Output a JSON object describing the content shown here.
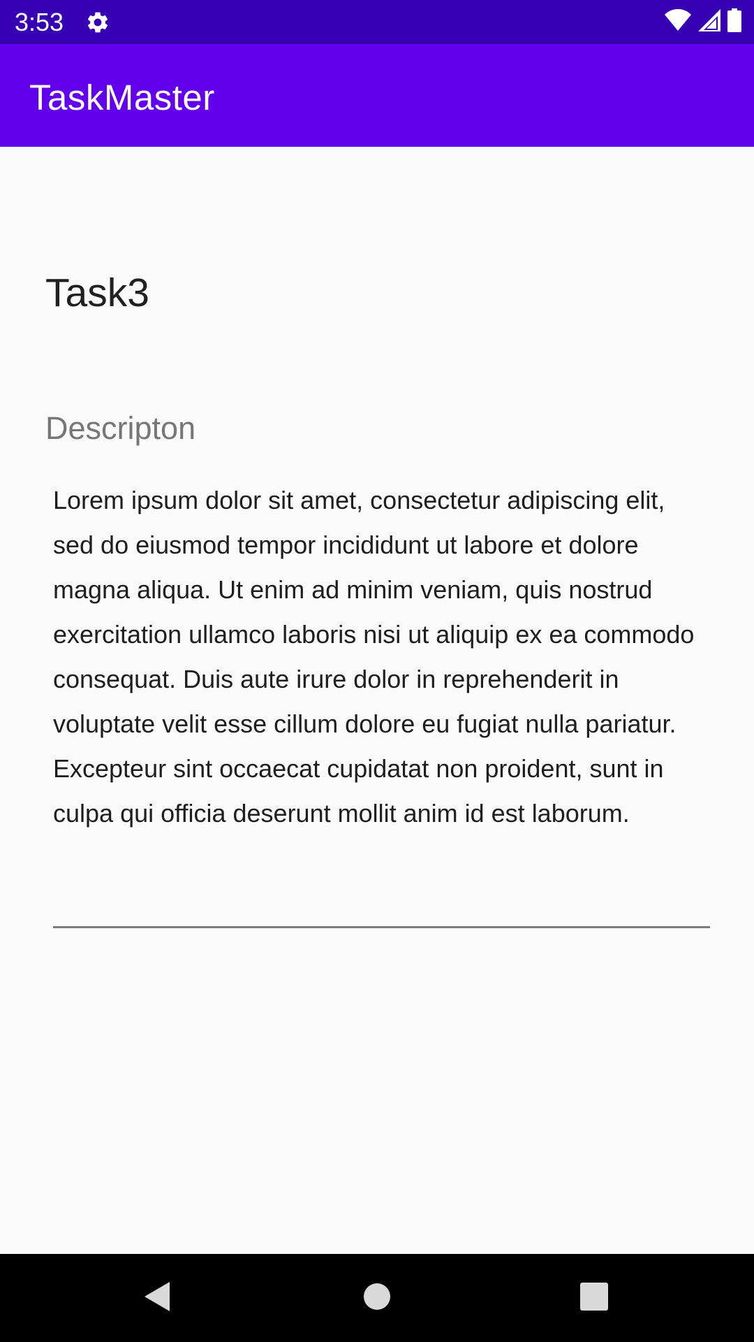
{
  "status_bar": {
    "time": "3:53",
    "icons": [
      "gear-icon",
      "wifi-icon",
      "signal-icon",
      "battery-icon"
    ]
  },
  "app_bar": {
    "title": "TaskMaster",
    "color": "#6200ee",
    "status_color": "#3700b3"
  },
  "task": {
    "title": "Task3",
    "description_label": "Descripton",
    "description": "Lorem ipsum dolor sit amet, consectetur adipiscing elit, sed do eiusmod tempor incididunt ut labore et dolore magna aliqua. Ut enim ad minim veniam, quis nostrud exercitation ullamco laboris nisi ut aliquip ex ea commodo consequat. Duis aute irure dolor in reprehenderit in voluptate velit esse cillum dolore eu fugiat nulla pariatur. Excepteur sint occaecat cupidatat non proident, sunt in culpa qui officia deserunt mollit anim id est laborum."
  },
  "nav_bar": {
    "buttons": [
      "back-icon",
      "home-icon",
      "recents-icon"
    ]
  }
}
